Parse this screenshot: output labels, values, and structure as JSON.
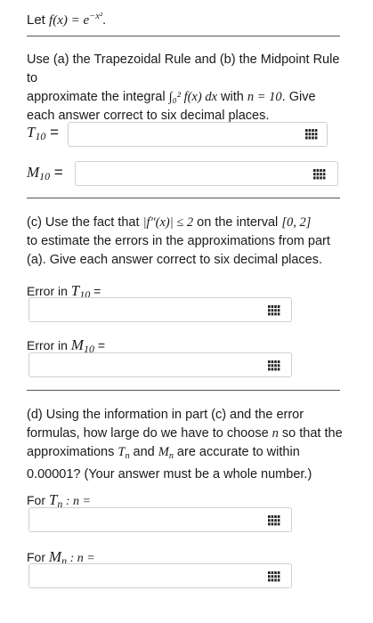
{
  "header": {
    "prefix": "Let ",
    "function": "f(x) = e",
    "exponent": "−x²",
    "suffix": "."
  },
  "partAB": {
    "line1": "Use (a) the Trapezoidal Rule and (b) the Midpoint Rule to",
    "line2_prefix": "approximate the integral ",
    "integral": "∫₀² f(x) dx",
    "line2_mid": " with ",
    "n_eq": "n = 10",
    "line2_suffix": ". Give",
    "line3": "each answer correct to six decimal places."
  },
  "T10": {
    "label": "T",
    "sub": "10",
    "eq": " =",
    "value": "",
    "placeholder": ""
  },
  "M10": {
    "label": "M",
    "sub": "10",
    "eq": " =",
    "value": "",
    "placeholder": ""
  },
  "partC": {
    "line1_prefix": "(c) Use the fact that ",
    "condition": "|f″(x)| ≤ 2",
    "line1_mid": " on the interval ",
    "interval": "[0, 2]",
    "line2": "to estimate the errors in the approximations from part",
    "line3": "(a). Give each answer correct to six decimal places."
  },
  "errT": {
    "prefix": "Error in ",
    "var": "T",
    "sub": "10",
    "eq": " =",
    "value": ""
  },
  "errM": {
    "prefix": "Error in ",
    "var": "M",
    "sub": "10",
    "eq": " =",
    "value": ""
  },
  "partD": {
    "line1": "(d) Using the information in part (c) and the error",
    "line2_prefix": "formulas, how large do we have to choose ",
    "line2_var": "n",
    "line2_suffix": " so that the",
    "line3_prefix": "approximations ",
    "Tn": "T",
    "line3_and": " and ",
    "Mn": "M",
    "line3_suffix": " are accurate to within",
    "line4": "0.00001? (Your answer must be a whole number.)"
  },
  "forT": {
    "prefix": "For ",
    "var": "T",
    "sub": "n",
    "suffix": " : n =",
    "value": ""
  },
  "forM": {
    "prefix": "For ",
    "var": "M",
    "sub": "n",
    "suffix": " : n =",
    "value": ""
  },
  "icons": {
    "keypad": "keypad-icon"
  }
}
